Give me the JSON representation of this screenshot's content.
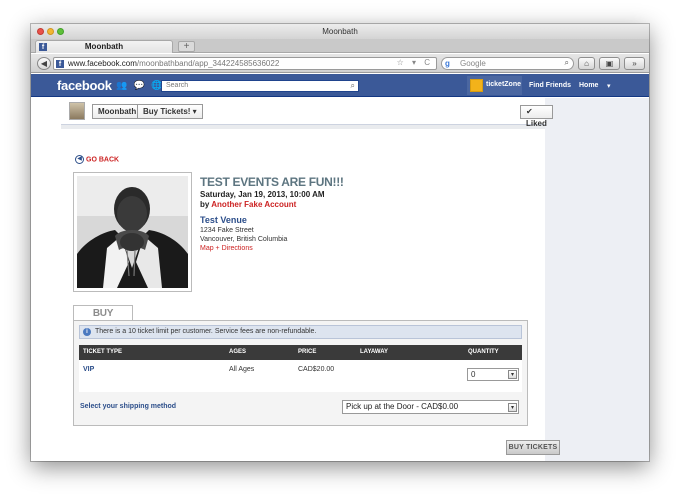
{
  "browser": {
    "window_title": "Moonbath",
    "tab_title": "Moonbath",
    "tab_favicon": "f",
    "new_tab": "+",
    "back": "◀",
    "url_domain": "www.facebook.com",
    "url_path": "/moonbathband/app_344224585636022",
    "url_icons": "☆ ▾ C",
    "search_engine": "g",
    "search_placeholder": "Google",
    "search_icon": "⌕",
    "home_icon": "⌂",
    "bookmarks_icon": "▣",
    "extra_icon": "»"
  },
  "facebook": {
    "logo": "facebook",
    "jewels": "👥 💬 🌐",
    "search_placeholder": "Search",
    "search_icon": "⌕",
    "page_switch": "ticketZone",
    "find_friends": "Find Friends",
    "home": "Home",
    "menu_arrow": "▾"
  },
  "page_header": {
    "page_name": "Moonbath",
    "buy_tickets_tab": "Buy Tickets! ▾",
    "liked": "✔ Liked"
  },
  "event": {
    "go_back": "GO BACK",
    "go_back_icon": "◀",
    "title": "TEST EVENTS ARE FUN!!!",
    "datetime": "Saturday, Jan 19, 2013, 10:00 AM",
    "by_prefix": "by ",
    "organizer": "Another Fake Account",
    "venue": "Test Venue",
    "address_line1": "1234 Fake Street",
    "address_line2": "Vancouver, British Columbia",
    "map_link": "Map + Directions"
  },
  "tickets": {
    "section_title": "BUY TICKETS",
    "notice_icon": "i",
    "notice": "There is a 10 ticket limit per customer. Service fees are non-refundable.",
    "columns": [
      "TICKET TYPE",
      "AGES",
      "PRICE",
      "LAYAWAY",
      "QUANTITY"
    ],
    "rows": [
      {
        "type": "VIP",
        "ages": "All Ages",
        "price": "CAD$20.00",
        "layaway": "",
        "quantity": "0"
      }
    ],
    "shipping_label": "Select your shipping method",
    "shipping_value": "Pick up at the Door - CAD$0.00",
    "select_arrow": "▾",
    "buy_button": "BUY TICKETS"
  },
  "colors": {
    "facebook_blue": "#3b5998",
    "link_red": "#cc2222",
    "link_blue": "#2c4e8a",
    "table_header": "#3a3a3a"
  }
}
